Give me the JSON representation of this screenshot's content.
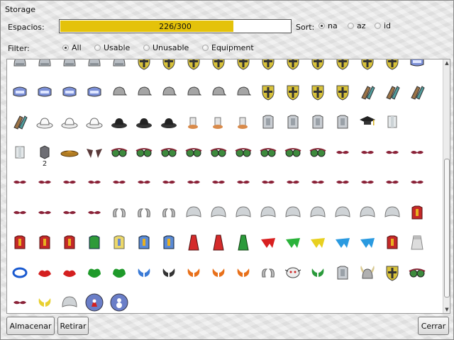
{
  "window": {
    "title": "Storage"
  },
  "capacity": {
    "label": "Espacios:",
    "text": "226/300",
    "used": 226,
    "total": 300
  },
  "sort": {
    "label": "Sort:",
    "options": [
      {
        "label": "na",
        "selected": true
      },
      {
        "label": "az",
        "selected": false
      },
      {
        "label": "id",
        "selected": false
      }
    ]
  },
  "filter": {
    "label": "Filter:",
    "options": [
      {
        "label": "All",
        "selected": true
      },
      {
        "label": "Usable",
        "selected": false
      },
      {
        "label": "Unusable",
        "selected": false
      },
      {
        "label": "Equipment",
        "selected": false
      }
    ]
  },
  "items": {
    "rows": [
      [
        "helmet-grey",
        "helmet-grey",
        "helmet-grey",
        "helmet-grey",
        "helmet-grey",
        "shield-cross",
        "shield-cross",
        "shield-cross",
        "shield-cross",
        "shield-cross",
        "shield-cross",
        "shield-cross",
        "shield-cross",
        "shield-cross",
        "shield-cross",
        "shield-cross",
        "mask-blue"
      ],
      [
        "mask-blue",
        "mask-blue",
        "mask-blue",
        "mask-blue",
        "cap-grey",
        "cap-grey",
        "cap-grey",
        "cap-grey",
        "cap-grey",
        "cap-grey",
        "shield-cross",
        "shield-cross",
        "shield-cross",
        "shield-cross",
        "boots-brown",
        "boots-brown",
        "boots-brown"
      ],
      [
        "boots-brown",
        "hat-white",
        "hat-white",
        "hat-white",
        "hat-black",
        "hat-black",
        "hat-black",
        "shoes-orange",
        "shoes-orange",
        "shoes-orange",
        "armor-silver",
        "armor-silver",
        "armor-silver",
        "armor-silver",
        "grad-cap",
        "vest-white"
      ],
      [
        "vest-white",
        "cube-grey",
        "hat-brown",
        "cat-ears",
        "goggles-green",
        "goggles-green",
        "goggles-green",
        "goggles-green",
        "goggles-green",
        "goggles-green",
        "goggles-green",
        "goggles-green",
        "goggles-green",
        "mustache-red",
        "mustache-red",
        "mustache-red",
        "mustache-red"
      ],
      [
        "mustache-red",
        "mustache-red",
        "mustache-red",
        "mustache-red",
        "mustache-red",
        "mustache-red",
        "mustache-red",
        "mustache-red",
        "mustache-red",
        "mustache-red",
        "mustache-red",
        "mustache-red",
        "mustache-red",
        "mustache-red",
        "mustache-red",
        "mustache-red",
        "mustache-red"
      ],
      [
        "mustache-red",
        "mustache-red",
        "mustache-red",
        "mustache-red",
        "horns-silver",
        "horns-silver",
        "horns-silver",
        "dome-grey",
        "dome-grey",
        "dome-grey",
        "dome-grey",
        "dome-grey",
        "dome-grey",
        "dome-grey",
        "dome-grey",
        "dome-grey",
        "armor-red"
      ],
      [
        "armor-red",
        "armor-red",
        "armor-red",
        "armor-green",
        "armor-yellow",
        "armor-blue",
        "armor-blue",
        "robe-red",
        "robe-red",
        "robe-green",
        "cape-red",
        "cape-green",
        "cape-yellow",
        "cape-blue",
        "cape-blue",
        "armor-red",
        "cloak-white"
      ],
      [
        "ring-blue",
        "gloves-red",
        "gloves-red",
        "gloves-green",
        "gloves-green",
        "wings-blue",
        "wings-black",
        "wings-orange",
        "wings-orange",
        "wings-orange",
        "horns-silver",
        "mask-face",
        "wings-green",
        "armor-silver",
        "helmet-horned",
        "shield-cross",
        "goggles-green"
      ],
      [
        "mustache-red",
        "wings-yellow",
        "dome-grey",
        "orb-santa",
        "orb-snowman"
      ]
    ],
    "counts": [
      {
        "row": 3,
        "col": 1,
        "text": "2"
      }
    ]
  },
  "buttons": {
    "store": "Almacenar",
    "retrieve": "Retirar",
    "close": "Cerrar"
  },
  "colors": {
    "progress_fill": "#e4c20a"
  }
}
